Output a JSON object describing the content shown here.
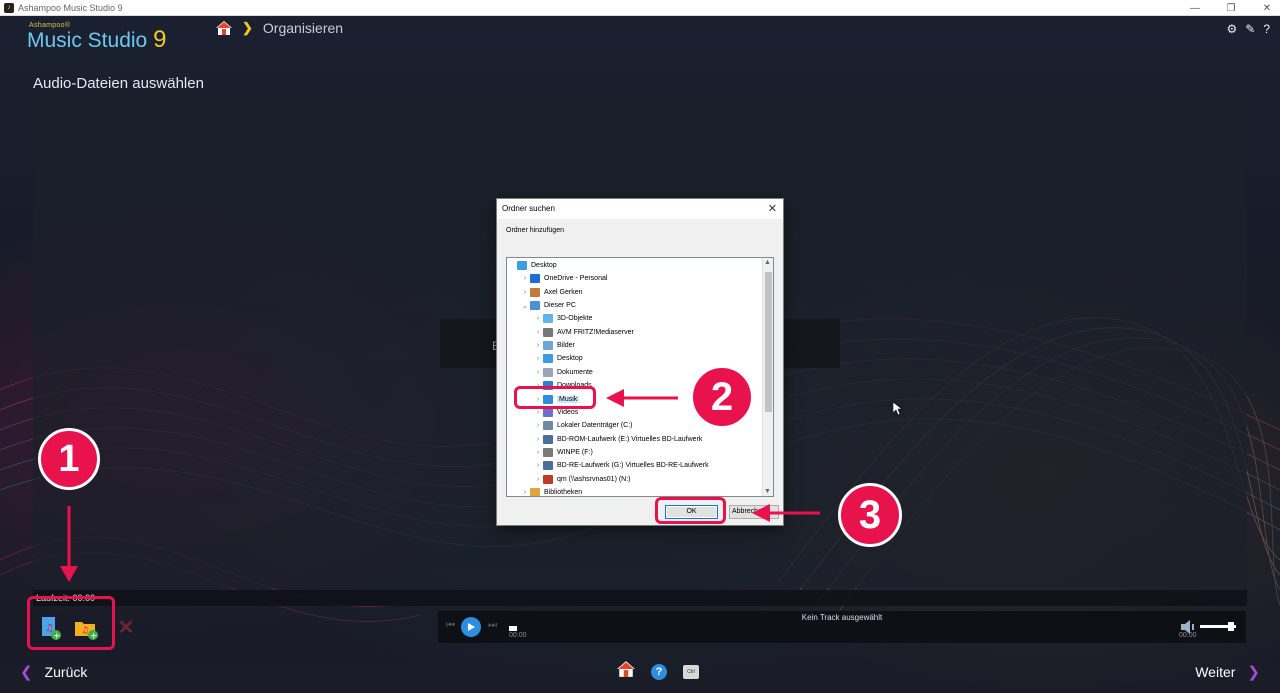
{
  "window": {
    "title": "Ashampoo Music Studio 9"
  },
  "brand": {
    "small": "Ashampoo®",
    "name": "Music Studio",
    "version": "9"
  },
  "breadcrumb": {
    "current": "Organisieren"
  },
  "page": {
    "title": "Audio-Dateien auswählen"
  },
  "hint": {
    "left_text": "E",
    "right_text": "."
  },
  "runtime": {
    "text": "Laufzeit: 00:00"
  },
  "player": {
    "track_label": "Kein Track ausgewählt",
    "time_start": "00:00",
    "time_end": "00:00"
  },
  "nav": {
    "back_label": "Zurück",
    "next_label": "Weiter",
    "ctrl_label": "Ctrl"
  },
  "dialog": {
    "title": "Ordner suchen",
    "label": "Ordner hinzufügen",
    "ok_label": "OK",
    "cancel_label": "Abbrechen",
    "tree": [
      {
        "label": "Desktop",
        "icon": "desktop-folder-icon",
        "level": 0,
        "expander": ""
      },
      {
        "label": "OneDrive - Personal",
        "icon": "onedrive-icon",
        "level": 1,
        "expander": ">"
      },
      {
        "label": "Axel Gerken",
        "icon": "user-icon",
        "level": 1,
        "expander": ">"
      },
      {
        "label": "Dieser PC",
        "icon": "computer-icon",
        "level": 1,
        "expander": "v"
      },
      {
        "label": "3D-Objekte",
        "icon": "3d-objects-icon",
        "level": 2,
        "expander": ">"
      },
      {
        "label": "AVM FRITZ!Mediaserver",
        "icon": "media-server-icon",
        "level": 2,
        "expander": ">"
      },
      {
        "label": "Bilder",
        "icon": "pictures-icon",
        "level": 2,
        "expander": ">"
      },
      {
        "label": "Desktop",
        "icon": "desktop-folder-icon",
        "level": 2,
        "expander": ">"
      },
      {
        "label": "Dokumente",
        "icon": "documents-icon",
        "level": 2,
        "expander": ">"
      },
      {
        "label": "Downloads",
        "icon": "downloads-icon",
        "level": 2,
        "expander": ">"
      },
      {
        "label": "Musik",
        "icon": "music-folder-icon",
        "level": 2,
        "expander": ">",
        "selected": true
      },
      {
        "label": "Videos",
        "icon": "videos-icon",
        "level": 2,
        "expander": ">"
      },
      {
        "label": "Lokaler Datenträger (C:)",
        "icon": "hard-drive-icon",
        "level": 2,
        "expander": ">"
      },
      {
        "label": "BD-ROM-Laufwerk (E:) Virtuelles BD-Laufwerk",
        "icon": "disc-drive-icon",
        "level": 2,
        "expander": ">"
      },
      {
        "label": "WINPE (F:)",
        "icon": "usb-drive-icon",
        "level": 2,
        "expander": ">"
      },
      {
        "label": "BD-RE-Laufwerk (G:) Virtuelles BD-RE-Laufwerk",
        "icon": "disc-drive-icon",
        "level": 2,
        "expander": ">"
      },
      {
        "label": "qm (\\\\ashsrvnas01) (N:)",
        "icon": "network-drive-icon",
        "level": 2,
        "expander": ">"
      },
      {
        "label": "Bibliotheken",
        "icon": "libraries-icon",
        "level": 1,
        "expander": ">"
      }
    ]
  },
  "annotations": {
    "step1": "1",
    "step2": "2",
    "step3": "3"
  },
  "colors": {
    "accent_pink": "#e8124d",
    "brand_blue": "#6ec8ee",
    "brand_yellow": "#f5c81d",
    "nav_purple": "#a24ed8"
  }
}
